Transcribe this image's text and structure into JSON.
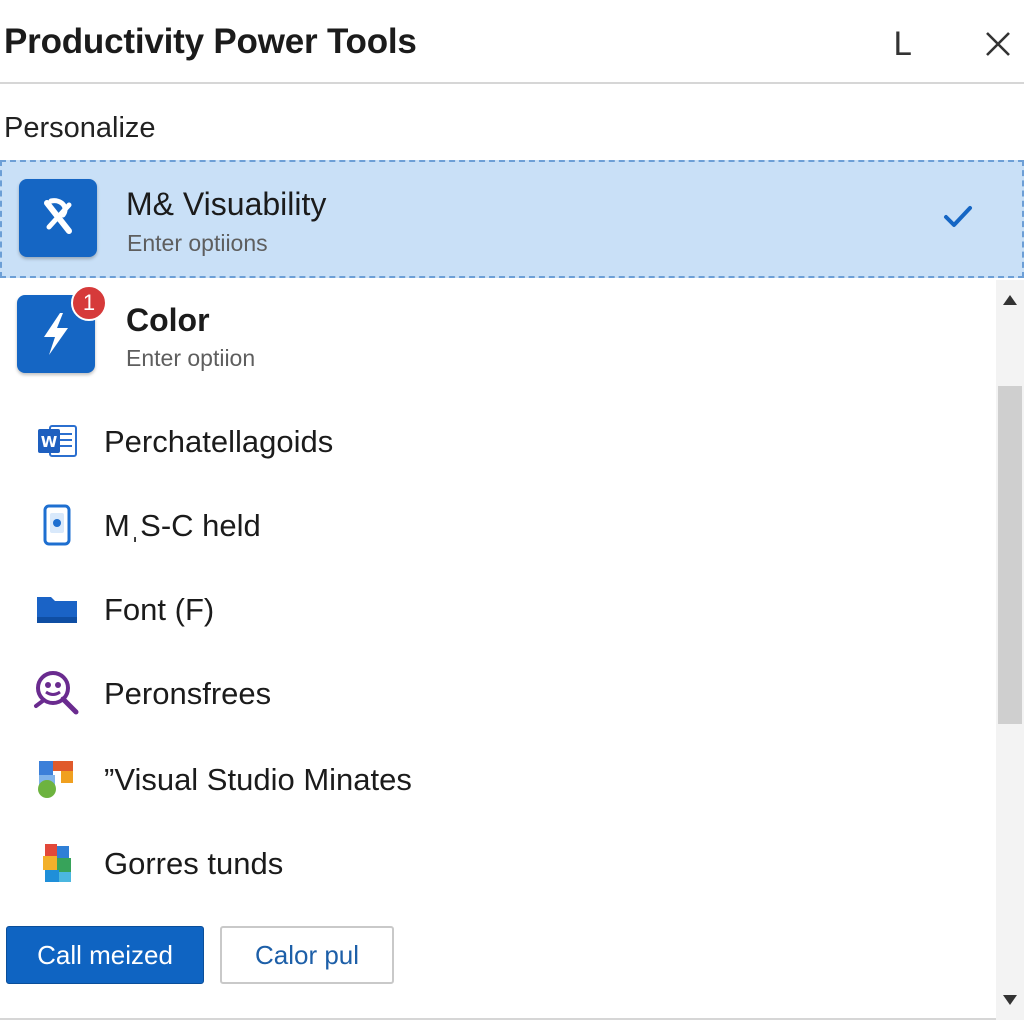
{
  "window": {
    "title": "Productivity Power Tools",
    "minimize_glyph": "L"
  },
  "section_title": "Personalize",
  "featured_items": [
    {
      "title": "M& Visuability",
      "subtitle": "Enter optiions",
      "icon": "tools-icon",
      "selected": true
    },
    {
      "title": "Color",
      "subtitle": "Enter optiion",
      "icon": "lightning-icon",
      "badge": "1"
    }
  ],
  "list_items": [
    {
      "label": "Perchatellagoids",
      "icon": "word-doc-icon"
    },
    {
      "label": "MˌS-C held",
      "icon": "phone-icon"
    },
    {
      "label": "Font (F)",
      "icon": "folder-icon"
    },
    {
      "label": "Peronsfrees",
      "icon": "magnifier-person-icon"
    },
    {
      "label": "”Visual Studio Minates",
      "icon": "color-blocks-icon"
    },
    {
      "label": "Gorres tunds",
      "icon": "cube-icon"
    }
  ],
  "buttons": {
    "primary": "Call meized",
    "secondary": "Calor pul"
  },
  "colors": {
    "accent": "#1566c4",
    "selection": "#c9e0f7",
    "badge": "#d63a3a"
  }
}
